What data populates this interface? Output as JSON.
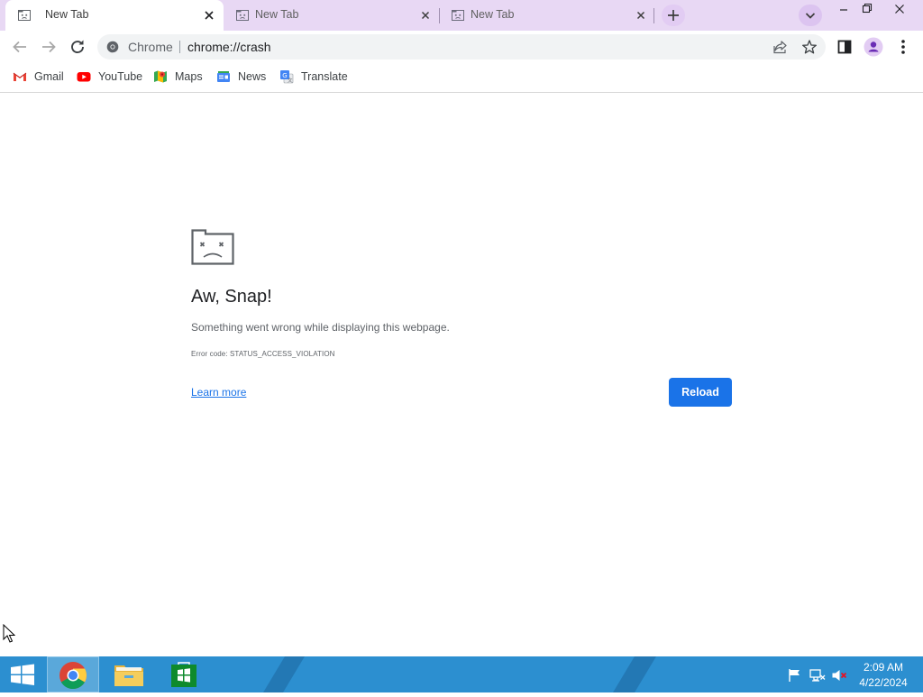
{
  "browser": {
    "tabs": [
      {
        "title": "New Tab",
        "active": true
      },
      {
        "title": "New Tab",
        "active": false
      },
      {
        "title": "New Tab",
        "active": false
      }
    ],
    "omnibox": {
      "site_label": "Chrome",
      "url": "chrome://crash"
    },
    "bookmarks": [
      {
        "label": "Gmail",
        "icon": "gmail-icon"
      },
      {
        "label": "YouTube",
        "icon": "youtube-icon"
      },
      {
        "label": "Maps",
        "icon": "maps-icon"
      },
      {
        "label": "News",
        "icon": "news-icon"
      },
      {
        "label": "Translate",
        "icon": "translate-icon"
      }
    ]
  },
  "crash_page": {
    "title": "Aw, Snap!",
    "message": "Something went wrong while displaying this webpage.",
    "error_code": "Error code: STATUS_ACCESS_VIOLATION",
    "learn_more": "Learn more",
    "reload_label": "Reload"
  },
  "taskbar": {
    "time": "2:09 AM",
    "date": "4/22/2024",
    "pinned": [
      "start-icon",
      "chrome-icon",
      "file-explorer-icon",
      "store-icon"
    ],
    "tray": [
      "action-center-flag-icon",
      "network-icon",
      "volume-muted-icon"
    ]
  },
  "colors": {
    "tab_strip": "#e8d8f4",
    "accent": "#1a73e8",
    "taskbar": "#2c8fd0"
  }
}
